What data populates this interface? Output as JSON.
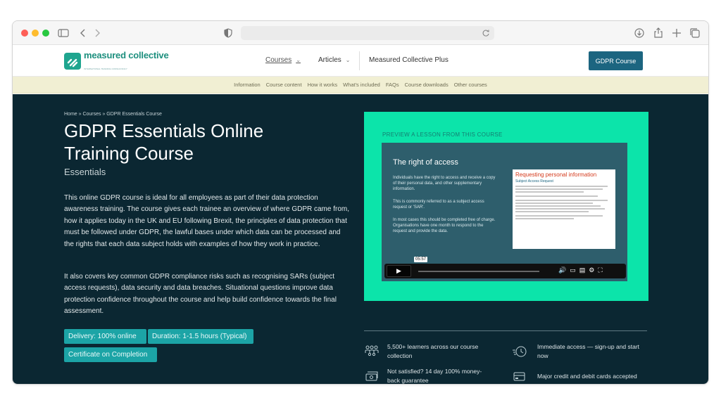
{
  "site": {
    "logo_name": "measured collective",
    "logo_tagline": "INTERNATIONAL TRAINING CONSULTANCY"
  },
  "nav": {
    "courses": "Courses",
    "articles": "Articles",
    "plus": "Measured Collective Plus",
    "cta": "GDPR Course"
  },
  "subnav": [
    "Information",
    "Course content",
    "How it works",
    "What's included",
    "FAQs",
    "Course downloads",
    "Other courses"
  ],
  "hero": {
    "breadcrumb": "Home » Courses » GDPR Essentials Course",
    "title": "GDPR Essentials Online Training Course",
    "subtitle": "Essentials",
    "paragraph1": "This online GDPR course is ideal for all employees as part of their data protection awareness training. The course gives each trainee an overview of where GDPR came from, how it applies today in the UK and EU following Brexit, the principles of data protection that must be followed under GDPR, the lawful bases under which data can be processed and the rights that each data subject holds with examples of how they work in practice.",
    "paragraph2": "It also covers key common GDPR compliance risks such as recognising SARs (subject access requests), data security and data breaches. Situational questions improve data protection confidence throughout the course and help build confidence towards the final assessment.",
    "badges": [
      "Delivery: 100% online",
      "Duration: 1-1.5 hours (Typical)",
      "Certificate on Completion"
    ]
  },
  "preview": {
    "label": "PREVIEW A LESSON FROM THIS COURSE",
    "slide_title": "The right of access",
    "slide_text1": "Individuals have the right to access and receive a copy of their personal data, and other supplementary information.",
    "slide_text2": "This is commonly referred to as a subject access request or 'SAR'.",
    "slide_text3": "In most cases this should be completed free of charge. Organisations have one month to respond to the request and provide the data.",
    "doc_heading": "Requesting personal information",
    "doc_sub": "Subject Access Request",
    "time": "05:57"
  },
  "features": [
    "5,500+ learners across our course collection",
    "Immediate access — sign-up and start now",
    "Not satisfied? 14 day 100% money-back guarantee",
    "Major credit and debit cards accepted"
  ]
}
